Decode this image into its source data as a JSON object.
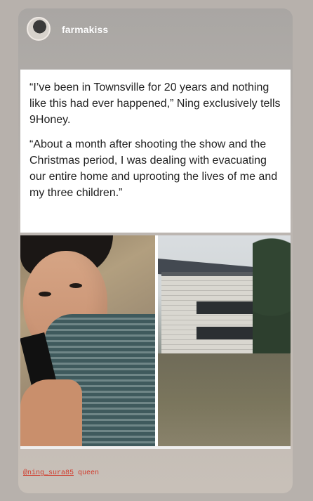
{
  "story": {
    "username": "farmakiss",
    "quote_paragraphs": [
      "“I’ve been in Townsville for 20 years and nothing like this had ever happened,” Ning exclusively tells 9Honey.",
      "“About a month after shooting the show and the Christmas period, I was dealing with evacuating our entire home and uprooting the lives of me and my three children.”"
    ],
    "mention": {
      "handle": "@ning_sura85",
      "suffix": "queen"
    }
  },
  "colors": {
    "background": "#b7b1ac",
    "card_background": "#ffffff",
    "mention_color": "#d03b2c"
  }
}
